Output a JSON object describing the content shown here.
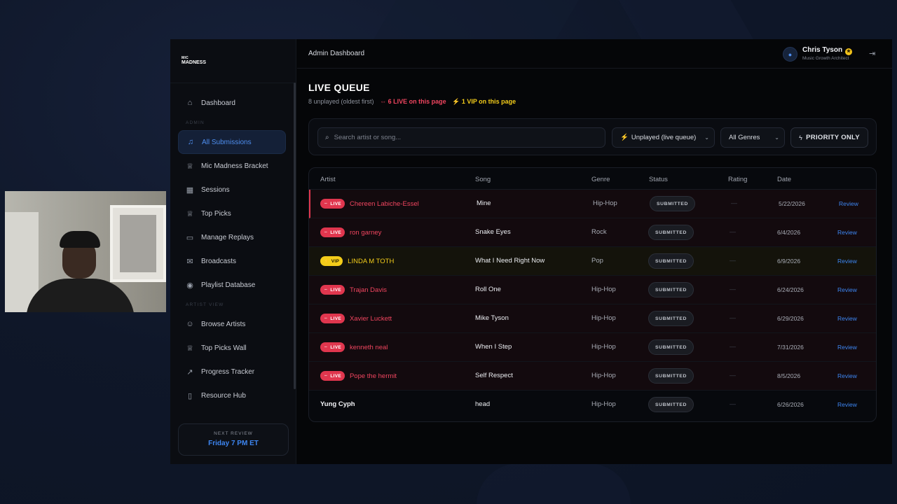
{
  "colors": {
    "accent": "#3d86f2",
    "live": "#e0364e",
    "vip": "#f3cc1a",
    "app_bg": "#050608",
    "desktop_bg": "#0f1729"
  },
  "brand": {
    "logo_line1": "MIC",
    "logo_line2": "MADNESS"
  },
  "sidebar": {
    "items": [
      {
        "label": "Dashboard",
        "icon": "home-icon",
        "active": false
      },
      {
        "label": "All Submissions",
        "icon": "music-note-icon",
        "active": true
      },
      {
        "label": "Mic Madness Bracket",
        "icon": "trophy-icon",
        "active": false
      },
      {
        "label": "Sessions",
        "icon": "calendar-icon",
        "active": false
      },
      {
        "label": "Top Picks",
        "icon": "trophy-icon",
        "active": false
      },
      {
        "label": "Manage Replays",
        "icon": "video-icon",
        "active": false
      },
      {
        "label": "Broadcasts",
        "icon": "mail-icon",
        "active": false
      },
      {
        "label": "Playlist Database",
        "icon": "spotify-icon",
        "active": false
      },
      {
        "label": "Browse Artists",
        "icon": "users-icon",
        "active": false
      },
      {
        "label": "Top Picks Wall",
        "icon": "trophy-icon",
        "active": false
      },
      {
        "label": "Progress Tracker",
        "icon": "trending-up-icon",
        "active": false
      },
      {
        "label": "Resource Hub",
        "icon": "book-icon",
        "active": false
      }
    ],
    "section_admin": "ADMIN",
    "section_artist": "ARTIST VIEW",
    "next_review_label": "NEXT REVIEW",
    "next_review_value": "Friday 7 PM ET"
  },
  "header": {
    "title": "Admin Dashboard",
    "user_name": "Chris Tyson",
    "user_role": "Music Growth Architect"
  },
  "queue": {
    "title": "LIVE QUEUE",
    "unplayed": "8 unplayed (oldest first)",
    "live_count": "6 LIVE on this page",
    "vip_count": "1 VIP on this page"
  },
  "filters": {
    "search_placeholder": "Search artist or song...",
    "status_value": "Unplayed (live queue)",
    "genre_value": "All Genres",
    "priority_label": "PRIORITY ONLY"
  },
  "table": {
    "columns": [
      "Artist",
      "Song",
      "Genre",
      "Status",
      "Rating",
      "Date"
    ],
    "rows": [
      {
        "badge": "LIVE",
        "artist": "Chereen Labiche-Essel",
        "song": "Mine",
        "genre": "Hip-Hop",
        "status": "SUBMITTED",
        "rating": "—",
        "date": "5/22/2026",
        "action": "Review"
      },
      {
        "badge": "LIVE",
        "artist": "ron garney",
        "song": "Snake Eyes",
        "genre": "Rock",
        "status": "SUBMITTED",
        "rating": "—",
        "date": "6/4/2026",
        "action": "Review"
      },
      {
        "badge": "VIP",
        "artist": "LINDA M TOTH",
        "song": "What I Need Right Now",
        "genre": "Pop",
        "status": "SUBMITTED",
        "rating": "—",
        "date": "6/9/2026",
        "action": "Review"
      },
      {
        "badge": "LIVE",
        "artist": "Trajan Davis",
        "song": "Roll One",
        "genre": "Hip-Hop",
        "status": "SUBMITTED",
        "rating": "—",
        "date": "6/24/2026",
        "action": "Review"
      },
      {
        "badge": "LIVE",
        "artist": "Xavier Luckett",
        "song": "Mike Tyson",
        "genre": "Hip-Hop",
        "status": "SUBMITTED",
        "rating": "—",
        "date": "6/29/2026",
        "action": "Review"
      },
      {
        "badge": "LIVE",
        "artist": "kenneth neal",
        "song": "When I Step",
        "genre": "Hip-Hop",
        "status": "SUBMITTED",
        "rating": "—",
        "date": "7/31/2026",
        "action": "Review"
      },
      {
        "badge": "LIVE",
        "artist": "Pope the hermit",
        "song": "Self Respect",
        "genre": "Hip-Hop",
        "status": "SUBMITTED",
        "rating": "—",
        "date": "8/5/2026",
        "action": "Review"
      },
      {
        "badge": "",
        "artist": "Yung Cyph",
        "song": "head",
        "genre": "Hip-Hop",
        "status": "SUBMITTED",
        "rating": "—",
        "date": "6/26/2026",
        "action": "Review"
      }
    ]
  }
}
